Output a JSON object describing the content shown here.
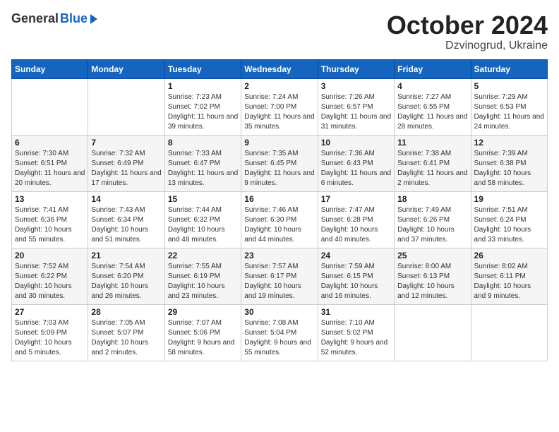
{
  "header": {
    "logo_general": "General",
    "logo_blue": "Blue",
    "month": "October 2024",
    "location": "Dzvinogrud, Ukraine"
  },
  "weekdays": [
    "Sunday",
    "Monday",
    "Tuesday",
    "Wednesday",
    "Thursday",
    "Friday",
    "Saturday"
  ],
  "weeks": [
    [
      {
        "day": "",
        "info": ""
      },
      {
        "day": "",
        "info": ""
      },
      {
        "day": "1",
        "info": "Sunrise: 7:23 AM\nSunset: 7:02 PM\nDaylight: 11 hours and 39 minutes."
      },
      {
        "day": "2",
        "info": "Sunrise: 7:24 AM\nSunset: 7:00 PM\nDaylight: 11 hours and 35 minutes."
      },
      {
        "day": "3",
        "info": "Sunrise: 7:26 AM\nSunset: 6:57 PM\nDaylight: 11 hours and 31 minutes."
      },
      {
        "day": "4",
        "info": "Sunrise: 7:27 AM\nSunset: 6:55 PM\nDaylight: 11 hours and 28 minutes."
      },
      {
        "day": "5",
        "info": "Sunrise: 7:29 AM\nSunset: 6:53 PM\nDaylight: 11 hours and 24 minutes."
      }
    ],
    [
      {
        "day": "6",
        "info": "Sunrise: 7:30 AM\nSunset: 6:51 PM\nDaylight: 11 hours and 20 minutes."
      },
      {
        "day": "7",
        "info": "Sunrise: 7:32 AM\nSunset: 6:49 PM\nDaylight: 11 hours and 17 minutes."
      },
      {
        "day": "8",
        "info": "Sunrise: 7:33 AM\nSunset: 6:47 PM\nDaylight: 11 hours and 13 minutes."
      },
      {
        "day": "9",
        "info": "Sunrise: 7:35 AM\nSunset: 6:45 PM\nDaylight: 11 hours and 9 minutes."
      },
      {
        "day": "10",
        "info": "Sunrise: 7:36 AM\nSunset: 6:43 PM\nDaylight: 11 hours and 6 minutes."
      },
      {
        "day": "11",
        "info": "Sunrise: 7:38 AM\nSunset: 6:41 PM\nDaylight: 11 hours and 2 minutes."
      },
      {
        "day": "12",
        "info": "Sunrise: 7:39 AM\nSunset: 6:38 PM\nDaylight: 10 hours and 58 minutes."
      }
    ],
    [
      {
        "day": "13",
        "info": "Sunrise: 7:41 AM\nSunset: 6:36 PM\nDaylight: 10 hours and 55 minutes."
      },
      {
        "day": "14",
        "info": "Sunrise: 7:43 AM\nSunset: 6:34 PM\nDaylight: 10 hours and 51 minutes."
      },
      {
        "day": "15",
        "info": "Sunrise: 7:44 AM\nSunset: 6:32 PM\nDaylight: 10 hours and 48 minutes."
      },
      {
        "day": "16",
        "info": "Sunrise: 7:46 AM\nSunset: 6:30 PM\nDaylight: 10 hours and 44 minutes."
      },
      {
        "day": "17",
        "info": "Sunrise: 7:47 AM\nSunset: 6:28 PM\nDaylight: 10 hours and 40 minutes."
      },
      {
        "day": "18",
        "info": "Sunrise: 7:49 AM\nSunset: 6:26 PM\nDaylight: 10 hours and 37 minutes."
      },
      {
        "day": "19",
        "info": "Sunrise: 7:51 AM\nSunset: 6:24 PM\nDaylight: 10 hours and 33 minutes."
      }
    ],
    [
      {
        "day": "20",
        "info": "Sunrise: 7:52 AM\nSunset: 6:22 PM\nDaylight: 10 hours and 30 minutes."
      },
      {
        "day": "21",
        "info": "Sunrise: 7:54 AM\nSunset: 6:20 PM\nDaylight: 10 hours and 26 minutes."
      },
      {
        "day": "22",
        "info": "Sunrise: 7:55 AM\nSunset: 6:19 PM\nDaylight: 10 hours and 23 minutes."
      },
      {
        "day": "23",
        "info": "Sunrise: 7:57 AM\nSunset: 6:17 PM\nDaylight: 10 hours and 19 minutes."
      },
      {
        "day": "24",
        "info": "Sunrise: 7:59 AM\nSunset: 6:15 PM\nDaylight: 10 hours and 16 minutes."
      },
      {
        "day": "25",
        "info": "Sunrise: 8:00 AM\nSunset: 6:13 PM\nDaylight: 10 hours and 12 minutes."
      },
      {
        "day": "26",
        "info": "Sunrise: 8:02 AM\nSunset: 6:11 PM\nDaylight: 10 hours and 9 minutes."
      }
    ],
    [
      {
        "day": "27",
        "info": "Sunrise: 7:03 AM\nSunset: 5:09 PM\nDaylight: 10 hours and 5 minutes."
      },
      {
        "day": "28",
        "info": "Sunrise: 7:05 AM\nSunset: 5:07 PM\nDaylight: 10 hours and 2 minutes."
      },
      {
        "day": "29",
        "info": "Sunrise: 7:07 AM\nSunset: 5:06 PM\nDaylight: 9 hours and 58 minutes."
      },
      {
        "day": "30",
        "info": "Sunrise: 7:08 AM\nSunset: 5:04 PM\nDaylight: 9 hours and 55 minutes."
      },
      {
        "day": "31",
        "info": "Sunrise: 7:10 AM\nSunset: 5:02 PM\nDaylight: 9 hours and 52 minutes."
      },
      {
        "day": "",
        "info": ""
      },
      {
        "day": "",
        "info": ""
      }
    ]
  ]
}
